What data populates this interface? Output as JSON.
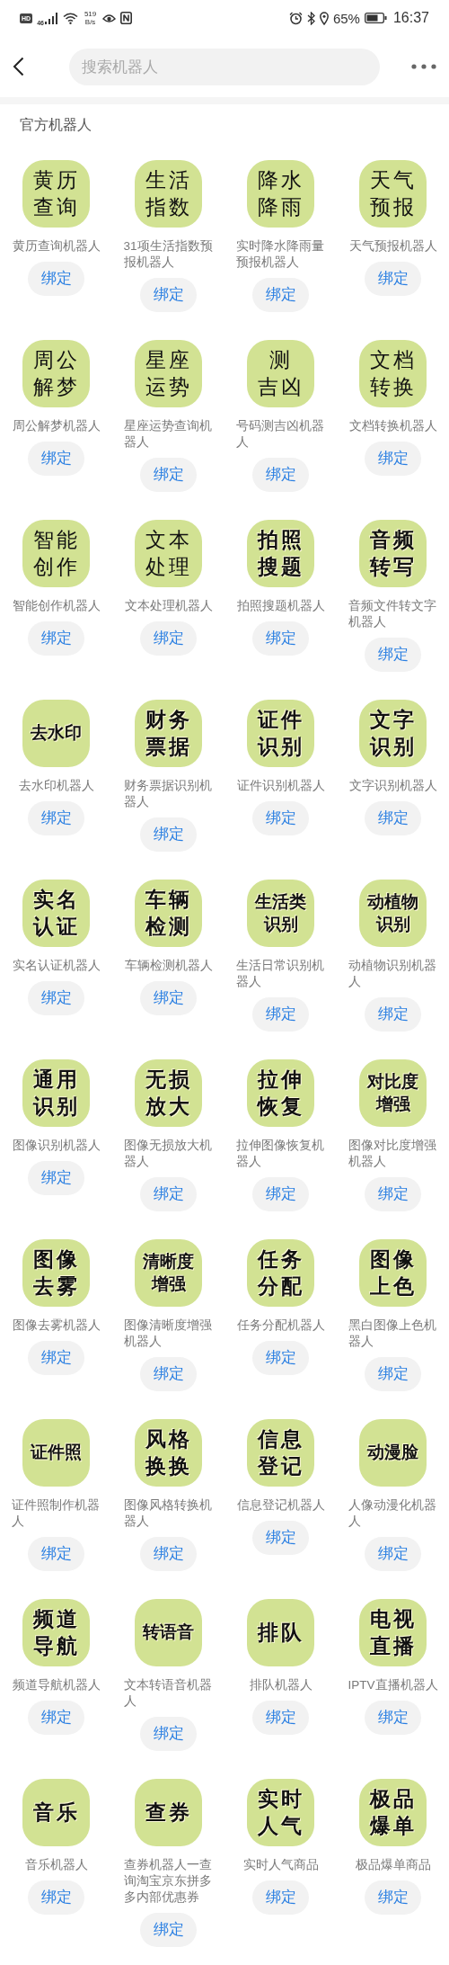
{
  "status_bar": {
    "hd_badge": "HD",
    "network": "46",
    "speed": "519",
    "speed_unit": "B/s",
    "battery_percent": "65%",
    "time": "16:37"
  },
  "header": {
    "search": {
      "placeholder": "搜索机器人"
    }
  },
  "section": {
    "title": "官方机器人",
    "robots": [
      {
        "icon_lines": [
          "黄历",
          "查询"
        ],
        "kind": "brush",
        "name": "黄历查询机器人",
        "button": "绑定"
      },
      {
        "icon_lines": [
          "生活",
          "指数"
        ],
        "kind": "brush",
        "name": "31项生活指数预报机器人",
        "button": "绑定"
      },
      {
        "icon_lines": [
          "降水",
          "降雨"
        ],
        "kind": "brush",
        "name": "实时降水降雨量预报机器人",
        "button": "绑定"
      },
      {
        "icon_lines": [
          "天气",
          "预报"
        ],
        "kind": "brush",
        "name": "天气预报机器人",
        "button": "绑定"
      },
      {
        "icon_lines": [
          "周公",
          "解梦"
        ],
        "kind": "brush",
        "name": "周公解梦机器人",
        "button": "绑定"
      },
      {
        "icon_lines": [
          "星座",
          "运势"
        ],
        "kind": "brush",
        "name": "星座运势查询机器人",
        "button": "绑定"
      },
      {
        "icon_lines": [
          "测",
          "吉凶"
        ],
        "kind": "brush",
        "name": "号码测吉凶机器人",
        "button": "绑定"
      },
      {
        "icon_lines": [
          "文档",
          "转换"
        ],
        "kind": "brush",
        "name": "文档转换机器人",
        "button": "绑定"
      },
      {
        "icon_lines": [
          "智能",
          "创作"
        ],
        "kind": "brush",
        "name": "智能创作机器人",
        "button": "绑定"
      },
      {
        "icon_lines": [
          "文本",
          "处理"
        ],
        "kind": "brush",
        "name": "文本处理机器人",
        "button": "绑定"
      },
      {
        "icon_lines": [
          "拍照",
          "搜题"
        ],
        "kind": "outlined",
        "name": "拍照搜题机器人",
        "button": "绑定"
      },
      {
        "icon_lines": [
          "音频",
          "转写"
        ],
        "kind": "outlined",
        "name": "音频文件转文字机器人",
        "button": "绑定"
      },
      {
        "icon_lines": [
          "去水印"
        ],
        "kind": "outlined",
        "name": "去水印机器人",
        "button": "绑定"
      },
      {
        "icon_lines": [
          "财务",
          "票据"
        ],
        "kind": "outlined",
        "name": "财务票据识别机器人",
        "button": "绑定"
      },
      {
        "icon_lines": [
          "证件",
          "识别"
        ],
        "kind": "outlined",
        "name": "证件识别机器人",
        "button": "绑定"
      },
      {
        "icon_lines": [
          "文字",
          "识别"
        ],
        "kind": "outlined",
        "name": "文字识别机器人",
        "button": "绑定"
      },
      {
        "icon_lines": [
          "实名",
          "认证"
        ],
        "kind": "outlined",
        "name": "实名认证机器人",
        "button": "绑定"
      },
      {
        "icon_lines": [
          "车辆",
          "检测"
        ],
        "kind": "outlined",
        "name": "车辆检测机器人",
        "button": "绑定"
      },
      {
        "icon_lines": [
          "生活类",
          "识别"
        ],
        "kind": "outlined",
        "name": "生活日常识别机器人",
        "button": "绑定"
      },
      {
        "icon_lines": [
          "动植物",
          "识别"
        ],
        "kind": "outlined",
        "name": "动植物识别机器人",
        "button": "绑定"
      },
      {
        "icon_lines": [
          "通用",
          "识别"
        ],
        "kind": "outlined",
        "name": "图像识别机器人",
        "button": "绑定"
      },
      {
        "icon_lines": [
          "无损",
          "放大"
        ],
        "kind": "outlined",
        "name": "图像无损放大机器人",
        "button": "绑定"
      },
      {
        "icon_lines": [
          "拉伸",
          "恢复"
        ],
        "kind": "outlined",
        "name": "拉伸图像恢复机器人",
        "button": "绑定"
      },
      {
        "icon_lines": [
          "对比度",
          "增强"
        ],
        "kind": "outlined",
        "name": "图像对比度增强机器人",
        "button": "绑定"
      },
      {
        "icon_lines": [
          "图像",
          "去雾"
        ],
        "kind": "outlined",
        "name": "图像去雾机器人",
        "button": "绑定"
      },
      {
        "icon_lines": [
          "清晰度",
          "增强"
        ],
        "kind": "outlined",
        "name": "图像清晰度增强机器人",
        "button": "绑定"
      },
      {
        "icon_lines": [
          "任务",
          "分配"
        ],
        "kind": "outlined",
        "name": "任务分配机器人",
        "button": "绑定"
      },
      {
        "icon_lines": [
          "图像",
          "上色"
        ],
        "kind": "outlined",
        "name": "黑白图像上色机器人",
        "button": "绑定"
      },
      {
        "icon_lines": [
          "证件照"
        ],
        "kind": "outlined",
        "name": "证件照制作机器人",
        "button": "绑定"
      },
      {
        "icon_lines": [
          "风格",
          "换换"
        ],
        "kind": "outlined",
        "name": "图像风格转换机器人",
        "button": "绑定"
      },
      {
        "icon_lines": [
          "信息",
          "登记"
        ],
        "kind": "outlined",
        "name": "信息登记机器人",
        "button": "绑定"
      },
      {
        "icon_lines": [
          "动漫脸"
        ],
        "kind": "outlined",
        "name": "人像动漫化机器人",
        "button": "绑定"
      },
      {
        "icon_lines": [
          "频道",
          "导航"
        ],
        "kind": "outlined",
        "name": "频道导航机器人",
        "button": "绑定"
      },
      {
        "icon_lines": [
          "转语音"
        ],
        "kind": "outlined",
        "name": "文本转语音机器人",
        "button": "绑定"
      },
      {
        "icon_lines": [
          "排队"
        ],
        "kind": "outlined",
        "name": "排队机器人",
        "button": "绑定"
      },
      {
        "icon_lines": [
          "电视",
          "直播"
        ],
        "kind": "outlined",
        "name": "IPTV直播机器人",
        "button": "绑定"
      },
      {
        "icon_lines": [
          "音乐"
        ],
        "kind": "outlined",
        "name": "音乐机器人",
        "button": "绑定"
      },
      {
        "icon_lines": [
          "查券"
        ],
        "kind": "outlined",
        "name": "查券机器人一查询淘宝京东拼多多内部优惠券",
        "button": "绑定"
      },
      {
        "icon_lines": [
          "实时",
          "人气"
        ],
        "kind": "outlined",
        "name": "实时人气商品",
        "button": "绑定"
      },
      {
        "icon_lines": [
          "极品",
          "爆单"
        ],
        "kind": "outlined",
        "name": "极品爆单商品",
        "button": "绑定"
      }
    ]
  }
}
